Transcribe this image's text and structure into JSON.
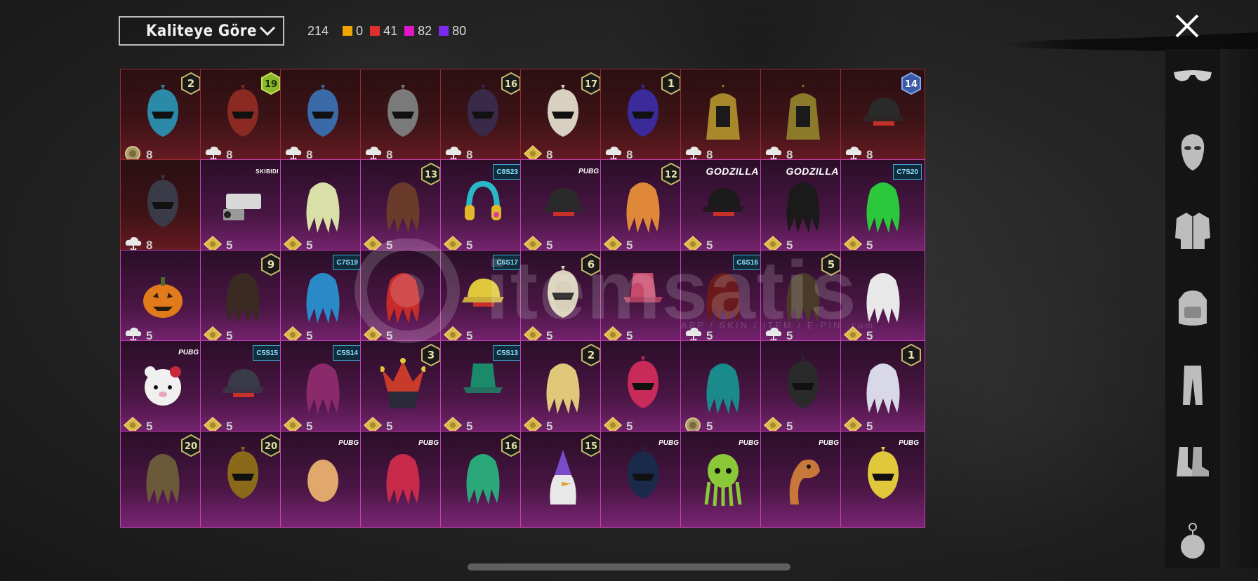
{
  "sort": {
    "label": "Kaliteye Göre"
  },
  "stats": {
    "total": "214",
    "items": [
      {
        "color": "#f0a500",
        "value": "0"
      },
      {
        "color": "#e0302c",
        "value": "41"
      },
      {
        "color": "#e016c8",
        "value": "82"
      },
      {
        "color": "#7b2bf0",
        "value": "80"
      }
    ]
  },
  "sidebar": {
    "items": [
      {
        "name": "glasses-icon"
      },
      {
        "name": "mask-icon"
      },
      {
        "name": "jacket-icon"
      },
      {
        "name": "backpack-icon"
      },
      {
        "name": "pants-icon"
      },
      {
        "name": "shoes-icon"
      },
      {
        "name": "charm-icon"
      }
    ]
  },
  "watermark": {
    "text": "itemsatis",
    "sub": "APP / SKIN / ITEM / E-PIN .com"
  },
  "grid": [
    [
      {
        "rarity": "red",
        "count": "8",
        "cur": "coin",
        "badge": "2",
        "art": "helmet",
        "c": "#2a8aa8"
      },
      {
        "rarity": "red",
        "count": "8",
        "cur": "cloud",
        "badge": "19",
        "art": "helmet",
        "c": "#8a2a22",
        "badgeStyle": "green"
      },
      {
        "rarity": "red",
        "count": "8",
        "cur": "cloud",
        "badge": "",
        "art": "helmet",
        "c": "#3a6aa8"
      },
      {
        "rarity": "red",
        "count": "8",
        "cur": "cloud",
        "badge": "",
        "art": "helmet",
        "c": "#7a7a7a"
      },
      {
        "rarity": "red",
        "count": "8",
        "cur": "cloud",
        "badge": "16",
        "art": "helmet",
        "c": "#3a2a4a"
      },
      {
        "rarity": "red",
        "count": "8",
        "cur": "gold",
        "badge": "17",
        "art": "helmet",
        "c": "#d8d0c0"
      },
      {
        "rarity": "red",
        "count": "8",
        "cur": "cloud",
        "badge": "1",
        "art": "helmet",
        "c": "#3a2a9a"
      },
      {
        "rarity": "red",
        "count": "8",
        "cur": "cloud",
        "badge": "",
        "art": "pharaoh",
        "c": "#a8882a"
      },
      {
        "rarity": "red",
        "count": "8",
        "cur": "cloud",
        "badge": "",
        "art": "pharaoh",
        "c": "#8a7a2a"
      },
      {
        "rarity": "red",
        "count": "8",
        "cur": "cloud",
        "badge": "14",
        "art": "cap",
        "c": "#2a2a2a",
        "badgeStyle": "blue"
      }
    ],
    [
      {
        "rarity": "red",
        "count": "8",
        "cur": "cloud",
        "badge": "",
        "art": "helmet",
        "c": "#3a3a48"
      },
      {
        "rarity": "pink",
        "count": "5",
        "cur": "gold",
        "tag": "SKIBIDI",
        "tagStyle": "skibidi",
        "art": "camera",
        "c": "#d8d8d8"
      },
      {
        "rarity": "pink",
        "count": "5",
        "cur": "gold",
        "badge": "",
        "art": "hair",
        "c": "#d8e0a8"
      },
      {
        "rarity": "pink",
        "count": "5",
        "cur": "gold",
        "badge": "13",
        "art": "hair",
        "c": "#6a3a2a"
      },
      {
        "rarity": "pink",
        "count": "5",
        "cur": "gold",
        "tag": "C8S23",
        "tagStyle": "season",
        "art": "headphones",
        "c": "#2ab8c8"
      },
      {
        "rarity": "pink",
        "count": "5",
        "cur": "gold",
        "tag": "PUBG",
        "tagStyle": "brand",
        "art": "cap",
        "c": "#2a2a2a"
      },
      {
        "rarity": "pink",
        "count": "5",
        "cur": "gold",
        "badge": "12",
        "art": "hair",
        "c": "#e0883a"
      },
      {
        "rarity": "pink",
        "count": "5",
        "cur": "gold",
        "tag": "GODZILLA",
        "tagStyle": "godzilla",
        "art": "cap",
        "c": "#1a1a1a"
      },
      {
        "rarity": "pink",
        "count": "5",
        "cur": "gold",
        "tag": "GODZILLA",
        "tagStyle": "godzilla",
        "art": "hair",
        "c": "#1a1a1a"
      },
      {
        "rarity": "pink",
        "count": "5",
        "cur": "gold",
        "tag": "C7S20",
        "tagStyle": "season",
        "art": "hair",
        "c": "#2ac83a"
      }
    ],
    [
      {
        "rarity": "pink",
        "count": "5",
        "cur": "cloud",
        "badge": "",
        "art": "pumpkin",
        "c": "#e07a1a"
      },
      {
        "rarity": "pink",
        "count": "5",
        "cur": "gold",
        "badge": "9",
        "art": "hair",
        "c": "#3a2a22"
      },
      {
        "rarity": "pink",
        "count": "5",
        "cur": "gold",
        "tag": "C7S19",
        "tagStyle": "season",
        "art": "hair",
        "c": "#2a8ac8"
      },
      {
        "rarity": "pink",
        "count": "5",
        "cur": "gold",
        "badge": "",
        "art": "hair",
        "c": "#c82a2a"
      },
      {
        "rarity": "pink",
        "count": "5",
        "cur": "gold",
        "tag": "C6S17",
        "tagStyle": "season",
        "art": "cap",
        "c": "#e0c83a"
      },
      {
        "rarity": "pink",
        "count": "5",
        "cur": "gold",
        "badge": "6",
        "art": "helmet",
        "c": "#d8d0b8"
      },
      {
        "rarity": "pink",
        "count": "5",
        "cur": "gold",
        "badge": "",
        "art": "hat",
        "c": "#c84a6a"
      },
      {
        "rarity": "pink",
        "count": "5",
        "cur": "cloud",
        "tag": "C6S16",
        "tagStyle": "season",
        "art": "hair",
        "c": "#6a1a1a"
      },
      {
        "rarity": "pink",
        "count": "5",
        "cur": "cloud",
        "badge": "5",
        "art": "hair",
        "c": "#4a3a2a"
      },
      {
        "rarity": "pink",
        "count": "5",
        "cur": "gold",
        "badge": "",
        "art": "hair",
        "c": "#e8e8e8"
      }
    ],
    [
      {
        "rarity": "pink",
        "count": "5",
        "cur": "gold",
        "tag": "PUBG",
        "tagStyle": "brand",
        "art": "bear",
        "c": "#f0f0f0"
      },
      {
        "rarity": "pink",
        "count": "5",
        "cur": "gold",
        "tag": "C5S15",
        "tagStyle": "season",
        "art": "cap",
        "c": "#3a3a48"
      },
      {
        "rarity": "pink",
        "count": "5",
        "cur": "gold",
        "tag": "C5S14",
        "tagStyle": "season",
        "art": "hair",
        "c": "#8a2a6a"
      },
      {
        "rarity": "pink",
        "count": "5",
        "cur": "gold",
        "badge": "3",
        "art": "jester",
        "c": "#c83a2a"
      },
      {
        "rarity": "pink",
        "count": "5",
        "cur": "gold",
        "tag": "C5S13",
        "tagStyle": "season",
        "art": "hat",
        "c": "#1a8a6a"
      },
      {
        "rarity": "pink",
        "count": "5",
        "cur": "gold",
        "badge": "2",
        "art": "hair",
        "c": "#e0c87a"
      },
      {
        "rarity": "pink",
        "count": "5",
        "cur": "gold",
        "badge": "",
        "art": "helmet",
        "c": "#c82a5a"
      },
      {
        "rarity": "pink",
        "count": "5",
        "cur": "coin",
        "badge": "",
        "art": "hair",
        "c": "#1a8a8a"
      },
      {
        "rarity": "pink",
        "count": "5",
        "cur": "gold",
        "badge": "",
        "art": "helmet",
        "c": "#2a2a2a"
      },
      {
        "rarity": "pink",
        "count": "5",
        "cur": "gold",
        "badge": "1",
        "art": "hair",
        "c": "#d8d8e8"
      }
    ],
    [
      {
        "rarity": "pink",
        "count": "",
        "cur": "",
        "badge": "20",
        "art": "hair",
        "c": "#6a5a3a"
      },
      {
        "rarity": "pink",
        "count": "",
        "cur": "",
        "badge": "20",
        "art": "helmet",
        "c": "#8a6a1a"
      },
      {
        "rarity": "pink",
        "count": "",
        "cur": "",
        "tag": "PUBG",
        "tagStyle": "brand",
        "art": "egg",
        "c": "#e0a86a"
      },
      {
        "rarity": "pink",
        "count": "",
        "cur": "",
        "tag": "PUBG",
        "tagStyle": "brand",
        "art": "hair",
        "c": "#c82a4a"
      },
      {
        "rarity": "pink",
        "count": "",
        "cur": "",
        "badge": "16",
        "art": "hair",
        "c": "#2aa87a"
      },
      {
        "rarity": "pink",
        "count": "",
        "cur": "",
        "badge": "15",
        "art": "bird",
        "c": "#7a4ac8"
      },
      {
        "rarity": "pink",
        "count": "",
        "cur": "",
        "tag": "PUBG",
        "tagStyle": "brand",
        "art": "helmet",
        "c": "#1a2a4a"
      },
      {
        "rarity": "pink",
        "count": "",
        "cur": "",
        "tag": "PUBG",
        "tagStyle": "brand",
        "art": "octopus",
        "c": "#8ac83a"
      },
      {
        "rarity": "pink",
        "count": "",
        "cur": "",
        "tag": "PUBG",
        "tagStyle": "brand",
        "art": "snake",
        "c": "#c8783a"
      },
      {
        "rarity": "pink",
        "count": "",
        "cur": "",
        "tag": "PUBG",
        "tagStyle": "brand",
        "art": "helmet",
        "c": "#e0c83a"
      }
    ]
  ]
}
